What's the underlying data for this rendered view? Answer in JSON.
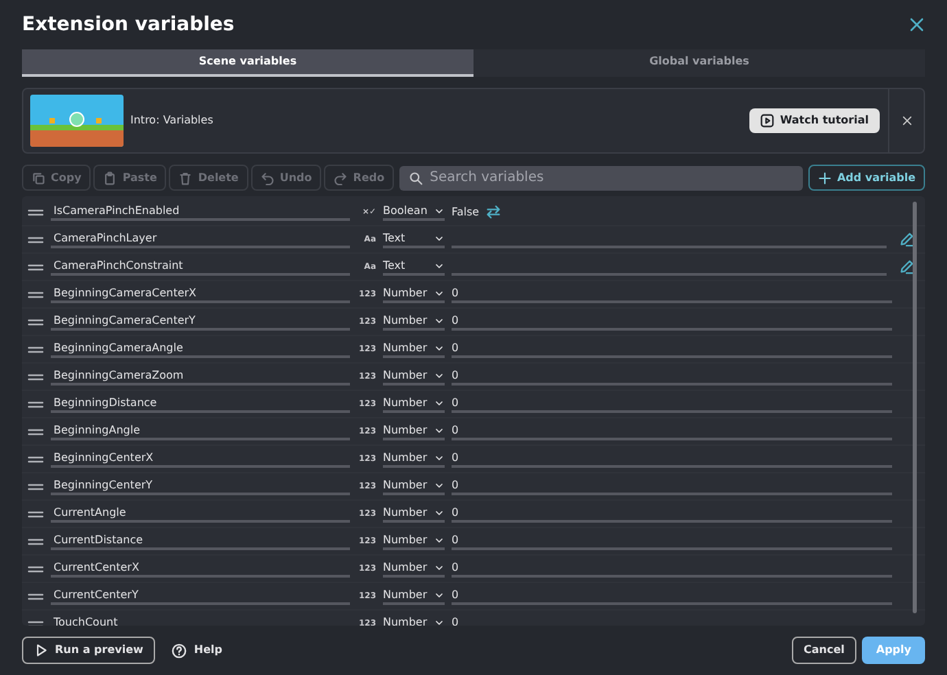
{
  "dialog": {
    "title": "Extension variables"
  },
  "tabs": [
    {
      "label": "Scene variables",
      "selected": true
    },
    {
      "label": "Global variables",
      "selected": false
    }
  ],
  "tutorial_banner": {
    "text": "Intro: Variables",
    "button": "Watch tutorial"
  },
  "toolbar": {
    "buttons": [
      {
        "label": "Copy",
        "disabled": true
      },
      {
        "label": "Paste",
        "disabled": true
      },
      {
        "label": "Delete",
        "disabled": true
      },
      {
        "label": "Undo",
        "disabled": true
      },
      {
        "label": "Redo",
        "disabled": true
      }
    ],
    "search": {
      "placeholder": "Search variables"
    },
    "add_button": "Add variable"
  },
  "variables": [
    {
      "name": "IsCameraPinchEnabled",
      "kind": "boolean",
      "type_icon": "×✓",
      "type": "Boolean",
      "value": "False"
    },
    {
      "name": "CameraPinchLayer",
      "kind": "text",
      "type_icon": "Aa",
      "type": "Text"
    },
    {
      "name": "CameraPinchConstraint",
      "kind": "text",
      "type_icon": "Aa",
      "type": "Text"
    },
    {
      "name": "BeginningCameraCenterX",
      "kind": "number",
      "type_icon": "123",
      "type": "Number",
      "value": "0"
    },
    {
      "name": "BeginningCameraCenterY",
      "kind": "number",
      "type_icon": "123",
      "type": "Number",
      "value": "0"
    },
    {
      "name": "BeginningCameraAngle",
      "kind": "number",
      "type_icon": "123",
      "type": "Number",
      "value": "0"
    },
    {
      "name": "BeginningCameraZoom",
      "kind": "number",
      "type_icon": "123",
      "type": "Number",
      "value": "0"
    },
    {
      "name": "BeginningDistance",
      "kind": "number",
      "type_icon": "123",
      "type": "Number",
      "value": "0"
    },
    {
      "name": "BeginningAngle",
      "kind": "number",
      "type_icon": "123",
      "type": "Number",
      "value": "0"
    },
    {
      "name": "BeginningCenterX",
      "kind": "number",
      "type_icon": "123",
      "type": "Number",
      "value": "0"
    },
    {
      "name": "BeginningCenterY",
      "kind": "number",
      "type_icon": "123",
      "type": "Number",
      "value": "0"
    },
    {
      "name": "CurrentAngle",
      "kind": "number",
      "type_icon": "123",
      "type": "Number",
      "value": "0"
    },
    {
      "name": "CurrentDistance",
      "kind": "number",
      "type_icon": "123",
      "type": "Number",
      "value": "0"
    },
    {
      "name": "CurrentCenterX",
      "kind": "number",
      "type_icon": "123",
      "type": "Number",
      "value": "0"
    },
    {
      "name": "CurrentCenterY",
      "kind": "number",
      "type_icon": "123",
      "type": "Number",
      "value": "0"
    },
    {
      "name": "TouchCount",
      "kind": "number",
      "type_icon": "123",
      "type": "Number",
      "value": "0"
    }
  ],
  "footer": {
    "preview_button": "Run a preview",
    "help": "Help",
    "cancel": "Cancel",
    "apply": "Apply"
  }
}
